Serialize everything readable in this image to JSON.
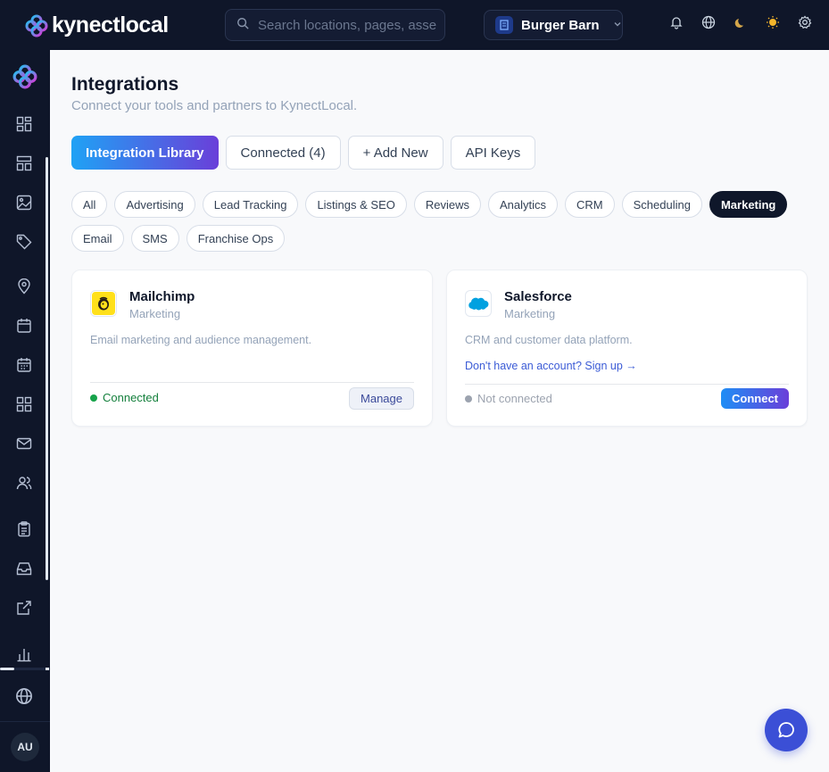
{
  "app": {
    "name": "kynectlocal"
  },
  "search": {
    "placeholder": "Search locations, pages, assets..."
  },
  "brand_selector": {
    "value": "Burger Barn"
  },
  "user": {
    "initials": "AU"
  },
  "page": {
    "title": "Integrations",
    "subtitle": "Connect your tools and partners to KynectLocal."
  },
  "tabs": [
    {
      "label": "Integration Library",
      "active": true
    },
    {
      "label": "Connected (4)",
      "active": false
    },
    {
      "label": "+ Add New",
      "active": false
    },
    {
      "label": "API Keys",
      "active": false
    }
  ],
  "filters": [
    {
      "label": "All"
    },
    {
      "label": "Advertising"
    },
    {
      "label": "Lead Tracking"
    },
    {
      "label": "Listings & SEO"
    },
    {
      "label": "Reviews"
    },
    {
      "label": "Analytics"
    },
    {
      "label": "CRM"
    },
    {
      "label": "Scheduling"
    },
    {
      "label": "Marketing",
      "active": true
    },
    {
      "label": "Email"
    },
    {
      "label": "SMS"
    },
    {
      "label": "Franchise Ops"
    }
  ],
  "integrations": [
    {
      "name": "Mailchimp",
      "category": "Marketing",
      "description": "Email marketing and audience management.",
      "status": "Connected",
      "action": "Manage"
    },
    {
      "name": "Salesforce",
      "category": "Marketing",
      "description": "CRM and customer data platform.",
      "signup_link": "Don't have an account? Sign up →",
      "status": "Not connected",
      "action": "Connect"
    }
  ],
  "colors": {
    "sidebar_bg": "#0f1629",
    "accent_start": "#1fa2f5",
    "accent_end": "#6a3fd9",
    "connected": "#16a34a",
    "not_connected": "#9ca3af"
  }
}
